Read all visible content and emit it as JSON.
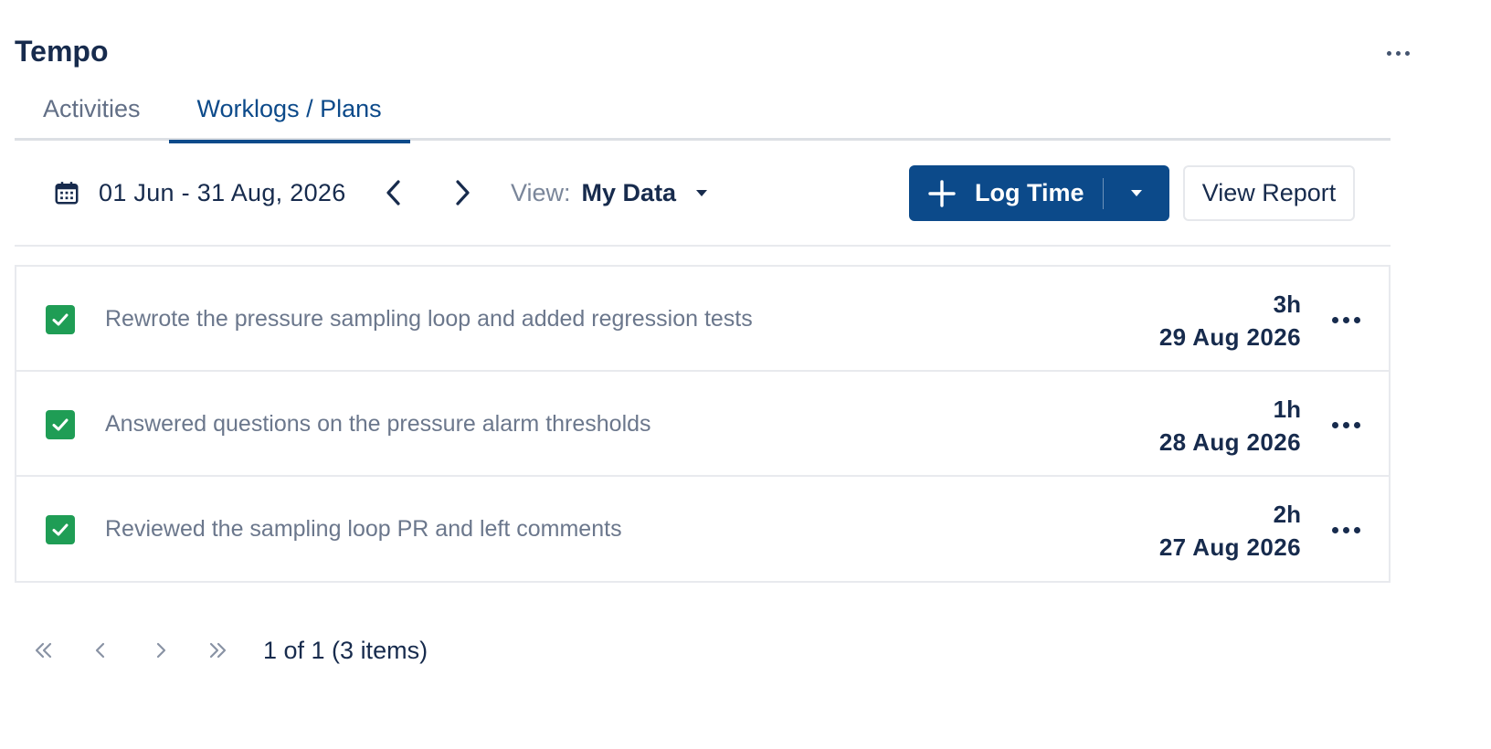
{
  "header": {
    "title": "Tempo"
  },
  "tabs": [
    {
      "label": "Activities",
      "active": false
    },
    {
      "label": "Worklogs / Plans",
      "active": true
    }
  ],
  "toolbar": {
    "date_range": "01 Jun - 31 Aug, 2026",
    "view_label": "View:",
    "view_value": "My Data",
    "log_time_label": "Log Time",
    "view_report_label": "View Report"
  },
  "worklogs": [
    {
      "description": "Rewrote the pressure sampling loop and added regression tests",
      "duration": "3h",
      "date": "29 Aug 2026",
      "checked": true
    },
    {
      "description": "Answered questions on the pressure alarm thresholds",
      "duration": "1h",
      "date": "28 Aug 2026",
      "checked": true
    },
    {
      "description": "Reviewed the sampling loop PR and left comments",
      "duration": "2h",
      "date": "27 Aug 2026",
      "checked": true
    }
  ],
  "pagination": {
    "summary": "1 of 1 (3 items)"
  },
  "colors": {
    "primary": "#0c4a8a",
    "check_green": "#1f9d55",
    "text_dark": "#172b4d",
    "text_muted": "#6b778c"
  }
}
